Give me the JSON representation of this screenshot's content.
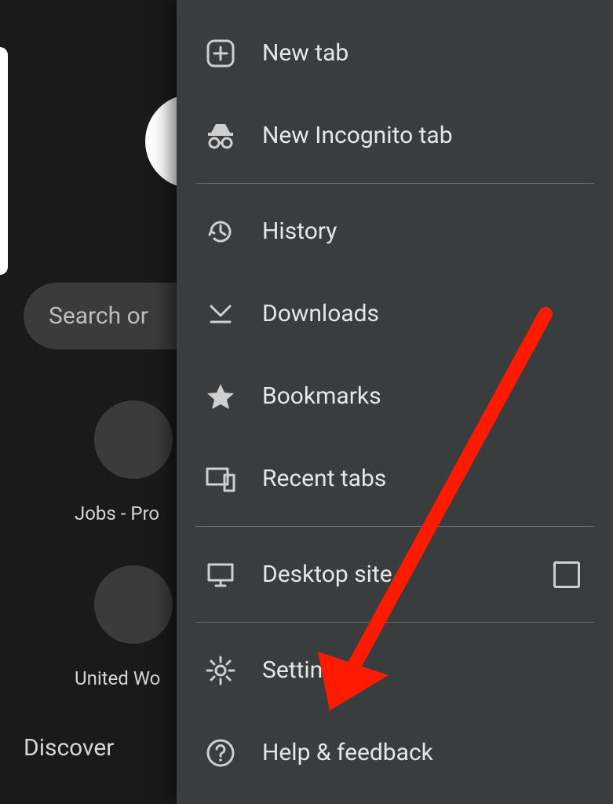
{
  "background": {
    "search_placeholder": "Search or ",
    "tile1_label": "Jobs - Pro",
    "tile2_label": "United Wo",
    "discover_label": "Discover"
  },
  "menu": {
    "new_tab": "New tab",
    "incognito": "New Incognito tab",
    "history": "History",
    "downloads": "Downloads",
    "bookmarks": "Bookmarks",
    "recent_tabs": "Recent tabs",
    "desktop_site": "Desktop site",
    "settings": "Settings",
    "help": "Help & feedback"
  }
}
